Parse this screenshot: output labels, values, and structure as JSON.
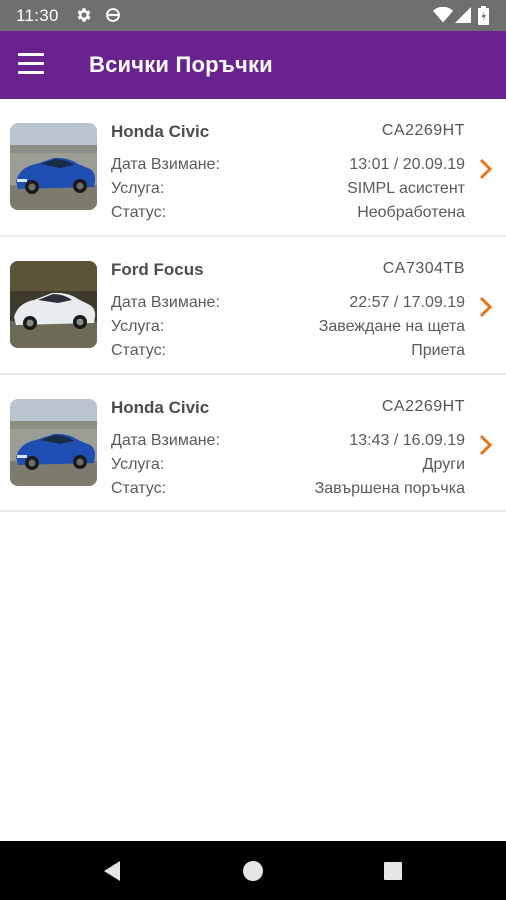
{
  "status_bar": {
    "time": "11:30",
    "icons": [
      "gear-icon",
      "opera-icon",
      "wifi-icon",
      "signal-icon",
      "battery-icon"
    ]
  },
  "app_bar": {
    "title": "Всички Поръчки",
    "menu_icon": "hamburger-icon",
    "background": "#6a238e"
  },
  "labels": {
    "pickup_date": "Дата Взимане:",
    "service": "Услуга:",
    "status": "Статус:"
  },
  "orders": [
    {
      "car": "Honda Civic",
      "plate": "CA2269HT",
      "pickup_date": "13:01 / 20.09.19",
      "service": "SIMPL асистент",
      "status": "Необработена",
      "car_color": "blue"
    },
    {
      "car": "Ford Focus",
      "plate": "CA7304TB",
      "pickup_date": "22:57 / 17.09.19",
      "service": "Завеждане на щета",
      "status": "Приета",
      "car_color": "white"
    },
    {
      "car": "Honda Civic",
      "plate": "CA2269HT",
      "pickup_date": "13:43 / 16.09.19",
      "service": "Други",
      "status": "Завършена поръчка",
      "car_color": "blue"
    }
  ],
  "colors": {
    "accent": "#6a238e",
    "chevron": "#e8741e"
  },
  "nav": {
    "icons": [
      "back-icon",
      "home-icon",
      "recents-icon"
    ]
  }
}
